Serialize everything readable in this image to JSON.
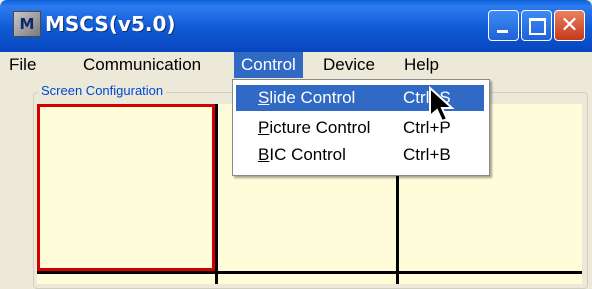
{
  "window": {
    "title": "MSCS(v5.0)",
    "icon": "app-logo-icon",
    "icon_glyph": "M",
    "controls": {
      "minimize": "minimize-icon",
      "maximize": "maximize-icon",
      "close_glyph": "✕"
    }
  },
  "menubar": {
    "items": [
      {
        "label": "File"
      },
      {
        "label": "Communication"
      },
      {
        "label": "Control",
        "active": true
      },
      {
        "label": "Device"
      },
      {
        "label": "Help"
      }
    ]
  },
  "group": {
    "label": "Screen Configuration"
  },
  "dropdown": {
    "items": [
      {
        "mnemonic": "S",
        "rest": "lide Control",
        "shortcut": "Ctrl+S",
        "highlighted": true
      },
      {
        "mnemonic": "P",
        "rest": "icture Control",
        "shortcut": "Ctrl+P"
      },
      {
        "mnemonic": "B",
        "rest": "IC Control",
        "shortcut": "Ctrl+B"
      }
    ]
  },
  "colors": {
    "titlebar": "#0A5FD6",
    "menu_highlight": "#316AC5",
    "cell_fill": "#FFFDD9",
    "selected_border": "#D40000",
    "group_label": "#0046D5"
  }
}
